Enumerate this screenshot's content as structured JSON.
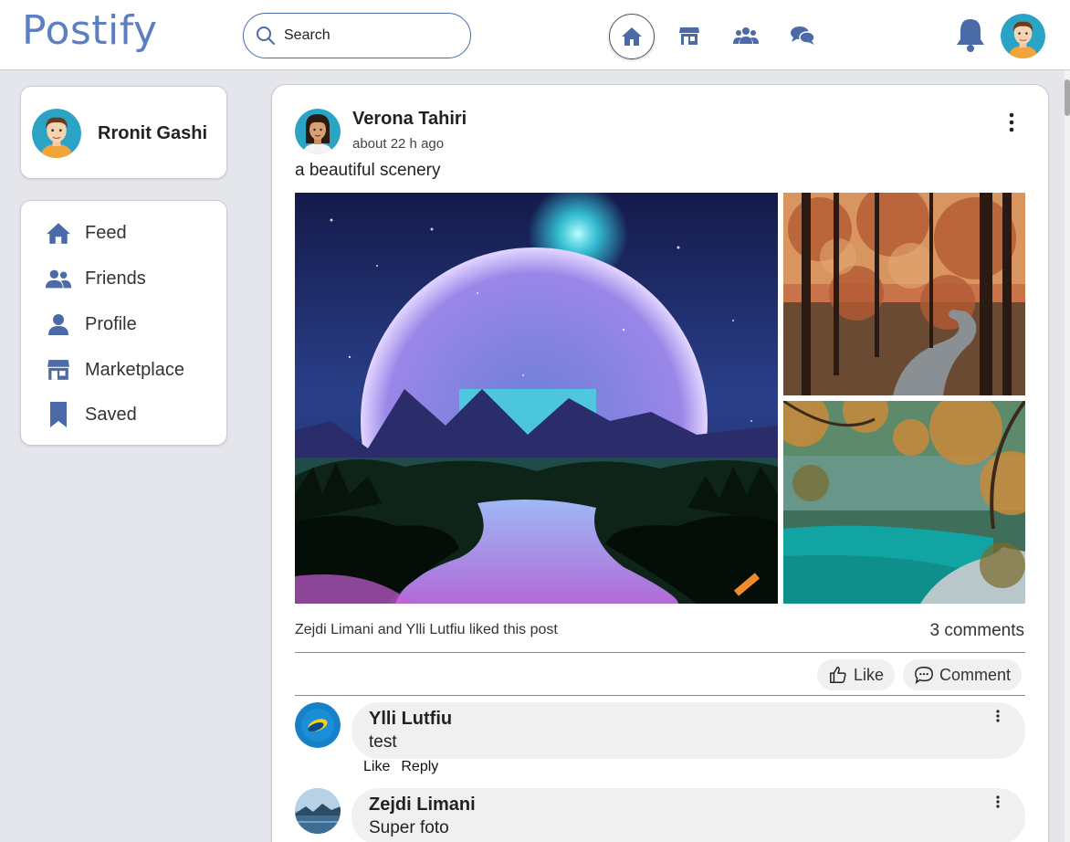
{
  "app": {
    "name": "Postify"
  },
  "search": {
    "placeholder": "Search"
  },
  "current_user": {
    "name": "Rronit Gashi"
  },
  "sidebar": {
    "items": [
      {
        "label": "Feed",
        "icon": "home-icon"
      },
      {
        "label": "Friends",
        "icon": "friends-icon"
      },
      {
        "label": "Profile",
        "icon": "profile-icon"
      },
      {
        "label": "Marketplace",
        "icon": "store-icon"
      },
      {
        "label": "Saved",
        "icon": "bookmark-icon"
      }
    ]
  },
  "post": {
    "author": "Verona Tahiri",
    "time": "about 22 h ago",
    "text": "a beautiful scenery",
    "likes_text": "Zejdi Limani and Ylli Lutfiu liked this post",
    "comments_count": "3 comments",
    "like_label": "Like",
    "comment_label": "Comment"
  },
  "comments": [
    {
      "author": "Ylli Lutfiu",
      "text": "test",
      "like_label": "Like",
      "reply_label": "Reply"
    },
    {
      "author": "Zejdi Limani",
      "text": "Super foto"
    }
  ],
  "colors": {
    "brand": "#5b7fc1",
    "icon": "#4a6aa8",
    "background": "#e4e6eb"
  }
}
